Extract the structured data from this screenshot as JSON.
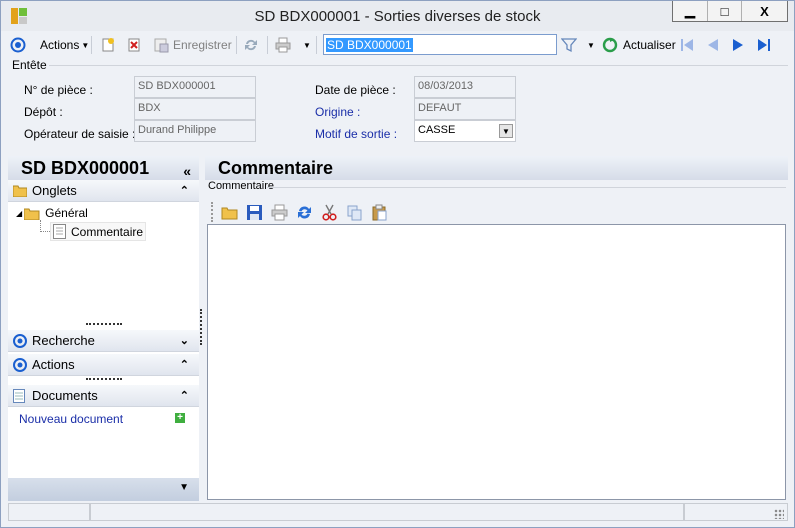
{
  "window": {
    "title": "SD BDX000001 -  Sorties diverses de stock",
    "minimize": "▁",
    "maximize": "□",
    "close": "X"
  },
  "toolbar": {
    "actions_label": "Actions",
    "save_label": "Enregistrer",
    "search_value": "SD BDX000001",
    "refresh_label": "Actualiser"
  },
  "header": {
    "section_label": "Entête",
    "fields": {
      "piece_label": "N° de pièce :",
      "piece_value": "SD BDX000001",
      "depot_label": "Dépôt :",
      "depot_value": "BDX",
      "operator_label": "Opérateur de saisie :",
      "operator_value": "Durand Philippe",
      "date_label": "Date de pièce :",
      "date_value": "08/03/2013",
      "origin_label": "Origine :",
      "origin_value": "DEFAUT",
      "motif_label": "Motif de sortie :",
      "motif_value": "CASSE"
    }
  },
  "left_panel": {
    "title": "SD BDX000001",
    "collapse": "«",
    "onglets_label": "Onglets",
    "tree": {
      "general": "Général",
      "commentaire": "Commentaire"
    },
    "recherche_label": "Recherche",
    "actions_label": "Actions",
    "documents_label": "Documents",
    "new_document": "Nouveau document"
  },
  "right_panel": {
    "title": "Commentaire",
    "group_label": "Commentaire",
    "editor_text": ""
  },
  "colors": {
    "accent_blue": "#1a5fd0",
    "link": "#1a2ea8",
    "selection": "#3399ff"
  }
}
